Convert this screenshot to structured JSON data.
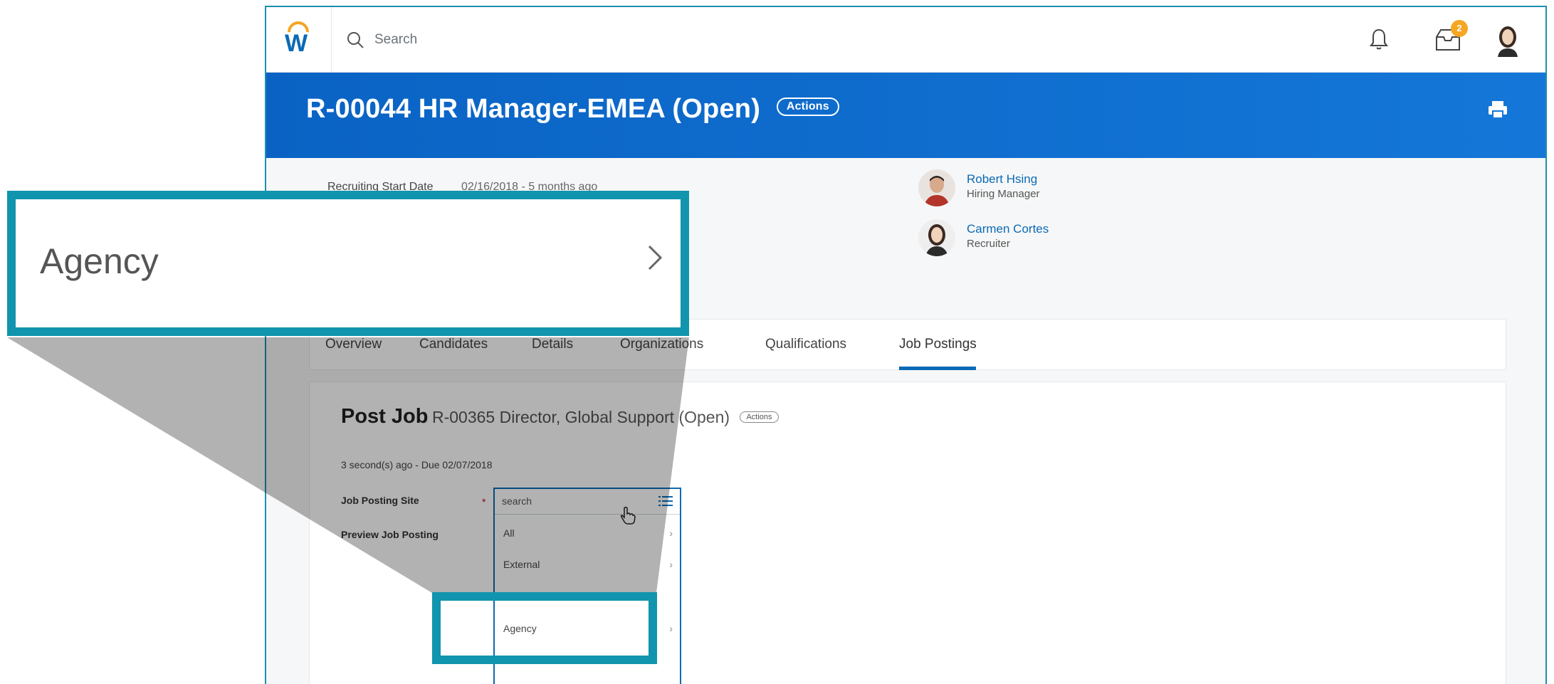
{
  "topnav": {
    "search_placeholder": "Search",
    "inbox_badge": "2"
  },
  "header": {
    "title": "R-00044 HR Manager-EMEA (Open)",
    "actions_label": "Actions"
  },
  "info": {
    "start_date_label": "Recruiting Start Date",
    "start_date_value": "02/16/2018 - 5 months ago",
    "people": [
      {
        "name": "Robert Hsing",
        "role": "Hiring Manager"
      },
      {
        "name": "Carmen Cortes",
        "role": "Recruiter"
      }
    ]
  },
  "tabs": [
    "Overview",
    "Candidates",
    "Details",
    "Organizations",
    "Qualifications",
    "Job Postings"
  ],
  "active_tab": "Job Postings",
  "post_job": {
    "title": "Post Job",
    "subtitle": "R-00365 Director, Global Support (Open)",
    "actions_label": "Actions",
    "due_text": "3 second(s) ago - Due 02/07/2018",
    "field_site_label": "Job Posting Site",
    "field_preview_label": "Preview Job Posting",
    "required_mark": "*"
  },
  "dropdown": {
    "input_value": "search",
    "options": [
      "All",
      "External",
      "Agency"
    ]
  },
  "zoom": {
    "label": "Agency"
  },
  "colors": {
    "brand_blue": "#0b6ab5",
    "header_blue": "#1477d8",
    "accent_orange": "#f5a623",
    "callout_teal": "#1194ad"
  }
}
